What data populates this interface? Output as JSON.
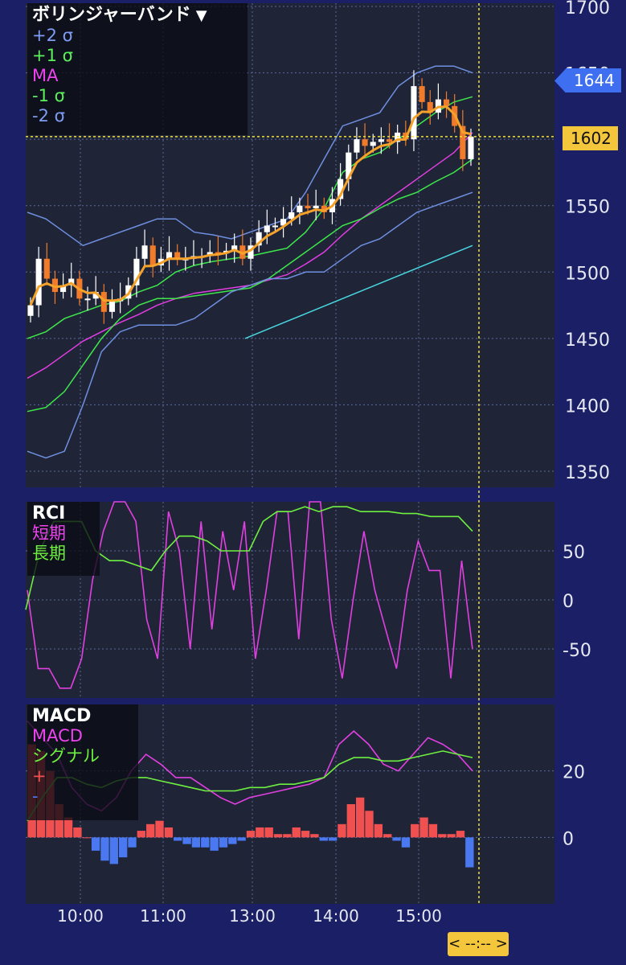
{
  "colors": {
    "background": "#1a1f66",
    "panel": "#1f2437",
    "grid": "#5a6a9a",
    "candle_up": "#ffffff",
    "candle_down": "#f07b2a",
    "plus2": "#6f8fe0",
    "plus1": "#3ee84a",
    "ma": "#e03ee0",
    "minus1": "#3ee84a",
    "minus2": "#6f8fe0",
    "ma_long": "#48d8e0",
    "ema": "#f5a22a",
    "rci_short": "#e040e0",
    "rci_long": "#6ef040",
    "macd": "#e040e0",
    "signal": "#6ef040",
    "hist_pos": "#f05050",
    "hist_neg": "#4a78f0",
    "crosshair": "#f4e23c"
  },
  "header": {
    "title": "ボリンジャーバンド",
    "caret": "▼"
  },
  "main_legend": [
    {
      "label": "+2 σ",
      "color": "#7f9cf5"
    },
    {
      "label": "+1 σ",
      "color": "#5cf05c"
    },
    {
      "label": "MA",
      "color": "#ee44ee"
    },
    {
      "label": "-1 σ",
      "color": "#5cf05c"
    },
    {
      "label": "-2 σ",
      "color": "#7f9cf5"
    }
  ],
  "rci_legend": {
    "title": "RCI",
    "items": [
      {
        "label": "短期",
        "color": "#ee44ee"
      },
      {
        "label": "長期",
        "color": "#6ef040"
      }
    ]
  },
  "macd_legend": {
    "title": "MACD",
    "items": [
      {
        "label": "MACD",
        "color": "#ee44ee"
      },
      {
        "label": "シグナル",
        "color": "#6ef040"
      },
      {
        "label": "+",
        "color": "#f05050"
      },
      {
        "label": "-",
        "color": "#4a78f0"
      }
    ]
  },
  "price_tags": {
    "last": "1644",
    "crosshair": "1602"
  },
  "time_handle": "< --:-- >",
  "chart_data": [
    {
      "type": "candlestick",
      "title": "ボリンジャーバンド",
      "ylim": [
        1350,
        1700
      ],
      "y_ticks": [
        "1700",
        "1650",
        "1600",
        "1550",
        "1500",
        "1450",
        "1400",
        "1350"
      ],
      "x_ticks": [
        "10:00",
        "11:00",
        "13:00",
        "14:00",
        "15:00"
      ],
      "crosshair_value": 1602,
      "last_value": 1644,
      "series_close": [
        1475,
        1510,
        1495,
        1485,
        1490,
        1495,
        1480,
        1480,
        1485,
        1470,
        1478,
        1480,
        1490,
        1510,
        1520,
        1505,
        1510,
        1515,
        1510,
        1510,
        1512,
        1512,
        1515,
        1514,
        1516,
        1520,
        1510,
        1520,
        1530,
        1535,
        1535,
        1540,
        1545,
        1550,
        1548,
        1550,
        1545,
        1555,
        1570,
        1590,
        1600,
        1595,
        1598,
        1600,
        1598,
        1605,
        1600,
        1640,
        1628,
        1620,
        1630,
        1625,
        1610,
        1585,
        1602
      ],
      "bb": {
        "plus2": [
          1545,
          1540,
          1530,
          1520,
          1525,
          1530,
          1535,
          1540,
          1540,
          1530,
          1528,
          1525,
          1530,
          1535,
          1540,
          1560,
          1585,
          1610,
          1615,
          1620,
          1640,
          1650,
          1655,
          1655,
          1650
        ],
        "plus1": [
          1450,
          1455,
          1465,
          1470,
          1475,
          1478,
          1485,
          1490,
          1500,
          1505,
          1508,
          1510,
          1512,
          1515,
          1518,
          1530,
          1548,
          1575,
          1585,
          1590,
          1600,
          1610,
          1620,
          1628,
          1632
        ],
        "ma": [
          1420,
          1428,
          1438,
          1448,
          1455,
          1462,
          1468,
          1475,
          1480,
          1484,
          1486,
          1488,
          1490,
          1494,
          1498,
          1506,
          1515,
          1528,
          1540,
          1550,
          1560,
          1570,
          1580,
          1590,
          1605
        ],
        "minus1": [
          1395,
          1398,
          1410,
          1430,
          1450,
          1465,
          1475,
          1480,
          1480,
          1482,
          1484,
          1486,
          1488,
          1495,
          1505,
          1515,
          1525,
          1535,
          1540,
          1548,
          1555,
          1560,
          1568,
          1575,
          1585
        ],
        "minus2": [
          1365,
          1360,
          1365,
          1400,
          1440,
          1455,
          1460,
          1460,
          1460,
          1465,
          1475,
          1485,
          1490,
          1495,
          1495,
          1500,
          1500,
          1510,
          1520,
          1525,
          1535,
          1545,
          1550,
          1555,
          1560
        ],
        "ma_long": [
          1450,
          1460,
          1470,
          1480,
          1490,
          1500,
          1510,
          1520
        ]
      }
    },
    {
      "type": "line",
      "title": "RCI",
      "ylim": [
        -100,
        100
      ],
      "y_ticks": [
        "50",
        "0",
        "-50"
      ],
      "series": [
        {
          "name": "短期",
          "values": [
            10,
            -70,
            -70,
            -90,
            -90,
            -60,
            20,
            70,
            100,
            100,
            80,
            -20,
            -60,
            90,
            50,
            -50,
            80,
            -30,
            70,
            10,
            80,
            -60,
            10,
            90,
            90,
            -40,
            100,
            100,
            -20,
            -80,
            0,
            70,
            10,
            -30,
            -70,
            10,
            60,
            30,
            30,
            -80,
            40,
            -50
          ]
        },
        {
          "name": "長期",
          "values": [
            -10,
            50,
            80,
            80,
            80,
            50,
            40,
            40,
            35,
            30,
            50,
            65,
            65,
            60,
            50,
            50,
            50,
            80,
            90,
            90,
            95,
            90,
            95,
            95,
            90,
            90,
            90,
            88,
            88,
            85,
            85,
            85,
            70
          ]
        }
      ]
    },
    {
      "type": "bar",
      "title": "MACD",
      "ylim": [
        -20,
        40
      ],
      "y_ticks": [
        "20",
        "0"
      ],
      "series": [
        {
          "name": "MACD",
          "values": [
            35,
            30,
            25,
            15,
            10,
            8,
            12,
            20,
            25,
            22,
            18,
            18,
            15,
            12,
            10,
            12,
            13,
            14,
            15,
            16,
            18,
            28,
            32,
            28,
            22,
            20,
            25,
            30,
            28,
            25,
            20
          ]
        },
        {
          "name": "シグナル",
          "values": [
            5,
            12,
            18,
            18,
            16,
            15,
            17,
            18,
            18,
            17,
            16,
            15,
            14,
            14,
            14,
            15,
            15,
            16,
            16,
            17,
            18,
            22,
            24,
            24,
            23,
            23,
            24,
            25,
            26,
            25,
            24
          ]
        },
        {
          "name": "histogram",
          "values": [
            28,
            26,
            20,
            10,
            6,
            3,
            0,
            -4,
            -7,
            -8,
            -6,
            -3,
            2,
            4,
            5,
            3,
            -1,
            -2,
            -3,
            -3,
            -4,
            -3,
            -2,
            -1,
            2,
            3,
            3,
            1,
            1,
            3,
            2,
            1,
            -1,
            -1,
            4,
            10,
            12,
            8,
            4,
            1,
            -1,
            -3,
            4,
            6,
            4,
            1,
            1,
            2,
            -9
          ]
        }
      ]
    }
  ]
}
